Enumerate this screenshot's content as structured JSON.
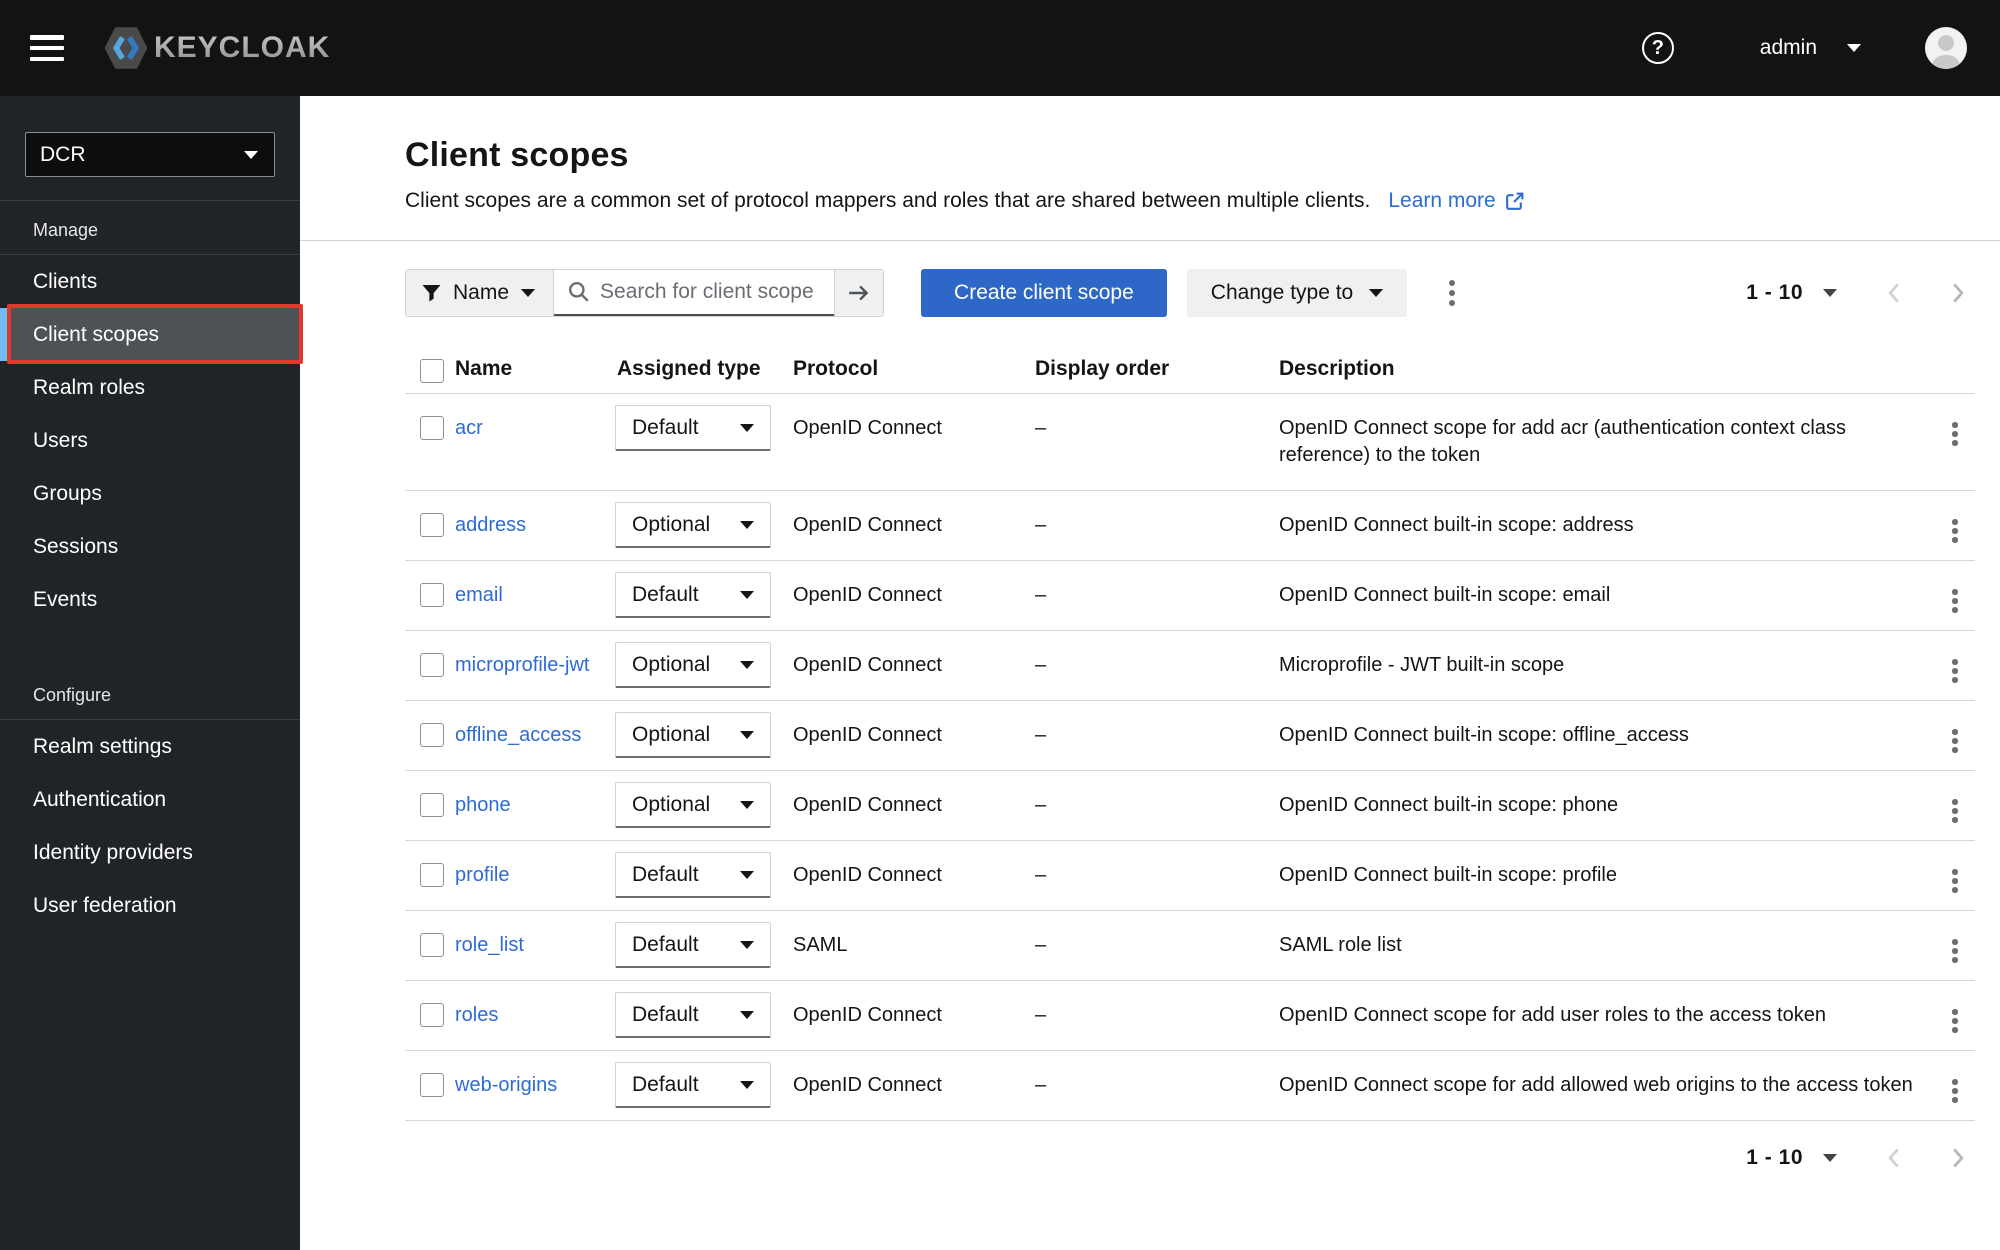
{
  "topbar": {
    "brand": "KEYCLOAK",
    "user": "admin"
  },
  "sidebar": {
    "realm": "DCR",
    "groups": [
      {
        "label": "Manage",
        "items": [
          {
            "label": "Clients"
          },
          {
            "label": "Client scopes",
            "active": true
          },
          {
            "label": "Realm roles"
          },
          {
            "label": "Users"
          },
          {
            "label": "Groups"
          },
          {
            "label": "Sessions"
          },
          {
            "label": "Events"
          }
        ]
      },
      {
        "label": "Configure",
        "items": [
          {
            "label": "Realm settings"
          },
          {
            "label": "Authentication"
          },
          {
            "label": "Identity providers"
          },
          {
            "label": "User federation"
          }
        ]
      }
    ]
  },
  "header": {
    "title": "Client scopes",
    "description": "Client scopes are a common set of protocol mappers and roles that are shared between multiple clients.",
    "learn_more": "Learn more"
  },
  "toolbar": {
    "filter_label": "Name",
    "search_placeholder": "Search for client scope",
    "create_label": "Create client scope",
    "change_type_label": "Change type to"
  },
  "pagination": {
    "range": "1 - 10"
  },
  "table": {
    "columns": [
      "Name",
      "Assigned type",
      "Protocol",
      "Display order",
      "Description"
    ],
    "rows": [
      {
        "name": "acr",
        "type": "Default",
        "protocol": "OpenID Connect",
        "display_order": "–",
        "description": "OpenID Connect scope for add acr (authentication context class reference) to the token"
      },
      {
        "name": "address",
        "type": "Optional",
        "protocol": "OpenID Connect",
        "display_order": "–",
        "description": "OpenID Connect built-in scope: address"
      },
      {
        "name": "email",
        "type": "Default",
        "protocol": "OpenID Connect",
        "display_order": "–",
        "description": "OpenID Connect built-in scope: email"
      },
      {
        "name": "microprofile-jwt",
        "type": "Optional",
        "protocol": "OpenID Connect",
        "display_order": "–",
        "description": "Microprofile - JWT built-in scope"
      },
      {
        "name": "offline_access",
        "type": "Optional",
        "protocol": "OpenID Connect",
        "display_order": "–",
        "description": "OpenID Connect built-in scope: offline_access"
      },
      {
        "name": "phone",
        "type": "Optional",
        "protocol": "OpenID Connect",
        "display_order": "–",
        "description": "OpenID Connect built-in scope: phone"
      },
      {
        "name": "profile",
        "type": "Default",
        "protocol": "OpenID Connect",
        "display_order": "–",
        "description": "OpenID Connect built-in scope: profile"
      },
      {
        "name": "role_list",
        "type": "Default",
        "protocol": "SAML",
        "display_order": "–",
        "description": "SAML role list"
      },
      {
        "name": "roles",
        "type": "Default",
        "protocol": "OpenID Connect",
        "display_order": "–",
        "description": "OpenID Connect scope for add user roles to the access token"
      },
      {
        "name": "web-origins",
        "type": "Default",
        "protocol": "OpenID Connect",
        "display_order": "–",
        "description": "OpenID Connect scope for add allowed web origins to the access token"
      }
    ]
  },
  "colors": {
    "primary_button": "#2d68c9",
    "link": "#2e6bd3",
    "active_nav_bg": "#4f5255",
    "active_nav_stripe": "#73bcf7",
    "annotation_red": "#e23a2a",
    "topbar_bg": "#131313",
    "sidebar_bg": "#212427"
  }
}
